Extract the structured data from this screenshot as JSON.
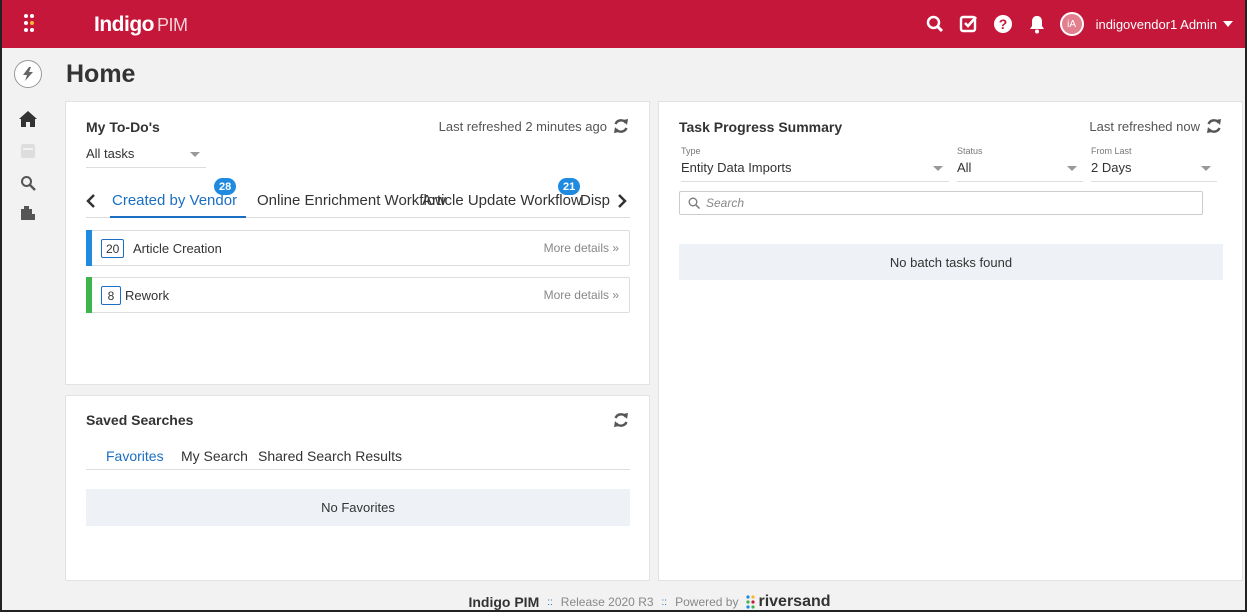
{
  "app": {
    "logo_main": "Indigo",
    "logo_sub": "PIM",
    "user_initials": "iA",
    "user_label": "indigovendor1 Admin",
    "brand_color": "#c4173a"
  },
  "page": {
    "title": "Home"
  },
  "todo": {
    "title": "My To-Do's",
    "refreshed": "Last refreshed 2 minutes ago",
    "filter": "All tasks",
    "tabs": [
      {
        "label": "Created by Vendor",
        "badge": "28"
      },
      {
        "label": "Online Enrichment Workflow",
        "badge": ""
      },
      {
        "label": "Article Update Workflow",
        "badge": "21"
      },
      {
        "label": "Disp",
        "badge": ""
      }
    ],
    "tasks": [
      {
        "count": "20",
        "name": "Article Creation",
        "more": "More details »",
        "color": "#1e8be0"
      },
      {
        "count": "8",
        "name": "Rework",
        "more": "More details »",
        "color": "#3cb54a"
      }
    ]
  },
  "task_progress": {
    "title": "Task Progress Summary",
    "refreshed": "Last refreshed now",
    "type_label": "Type",
    "type_value": "Entity Data Imports",
    "status_label": "Status",
    "status_value": "All",
    "from_label": "From Last",
    "from_value": "2 Days",
    "search_placeholder": "Search",
    "empty": "No batch tasks found"
  },
  "saved_searches": {
    "title": "Saved Searches",
    "tabs": [
      "Favorites",
      "My Search",
      "Shared Search Results"
    ],
    "empty": "No Favorites"
  },
  "footer": {
    "product": "Indigo PIM",
    "sep": "::",
    "release": "Release 2020 R3",
    "powered": "Powered by",
    "vendor": "riversand"
  }
}
